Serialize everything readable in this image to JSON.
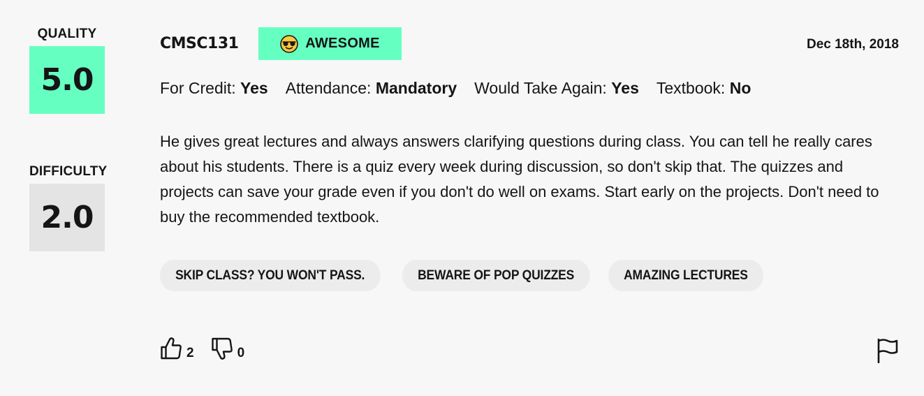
{
  "ratings": {
    "quality_label": "QUALITY",
    "quality_value": "5.0",
    "difficulty_label": "DIFFICULTY",
    "difficulty_value": "2.0"
  },
  "header": {
    "course": "CMSC131",
    "emotion": "AWESOME",
    "emotion_icon": "sunglasses-emoji-icon",
    "date": "Dec 18th, 2018"
  },
  "meta": {
    "for_credit_label": "For Credit:",
    "for_credit_value": "Yes",
    "attendance_label": "Attendance:",
    "attendance_value": "Mandatory",
    "take_again_label": "Would Take Again:",
    "take_again_value": "Yes",
    "textbook_label": "Textbook:",
    "textbook_value": "No"
  },
  "comment": "He gives great lectures and always answers clarifying questions during class. You can tell he really cares about his students. There is a quiz every week during discussion, so don't skip that. The quizzes and projects can save your grade even if you don't do well on exams. Start early on the projects. Don't need to buy the recommended textbook.",
  "tags": [
    "SKIP CLASS? YOU WON'T PASS.",
    "BEWARE OF POP QUIZZES",
    "AMAZING LECTURES"
  ],
  "footer": {
    "thumbs_up_count": "2",
    "thumbs_down_count": "0"
  },
  "colors": {
    "quality_bg": "#66ffc2",
    "difficulty_bg": "#e4e4e4",
    "tag_bg": "#ececec",
    "page_bg": "#f7f7f7"
  }
}
